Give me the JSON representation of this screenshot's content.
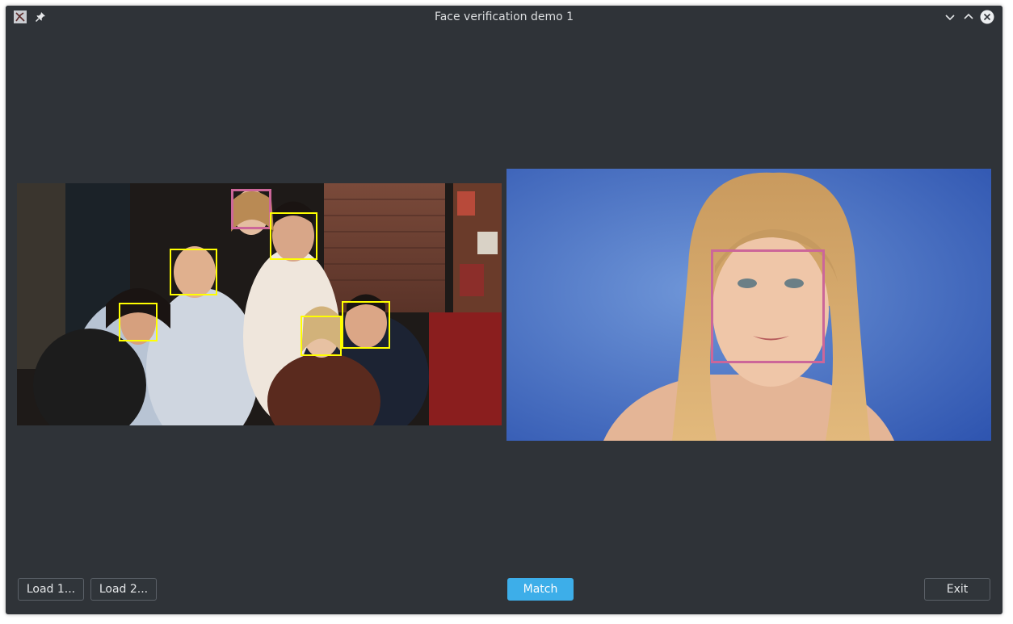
{
  "window": {
    "title": "Face verification demo 1"
  },
  "titlebar_icons": [
    "app-icon",
    "pin-icon",
    "minimize-icon",
    "maximize-icon",
    "close-icon"
  ],
  "images": {
    "left": {
      "face_count": 6,
      "highlight_color": "#cc6699",
      "box_color": "#ffff00"
    },
    "right": {
      "face_count": 1,
      "highlight_color": "#cc6699"
    }
  },
  "buttons": {
    "load1": "Load 1...",
    "load2": "Load 2...",
    "match": "Match",
    "exit": "Exit"
  },
  "colors": {
    "background": "#2f3338",
    "accent": "#3daee9",
    "match_box": "#cc6699",
    "face_box": "#ffff00"
  }
}
